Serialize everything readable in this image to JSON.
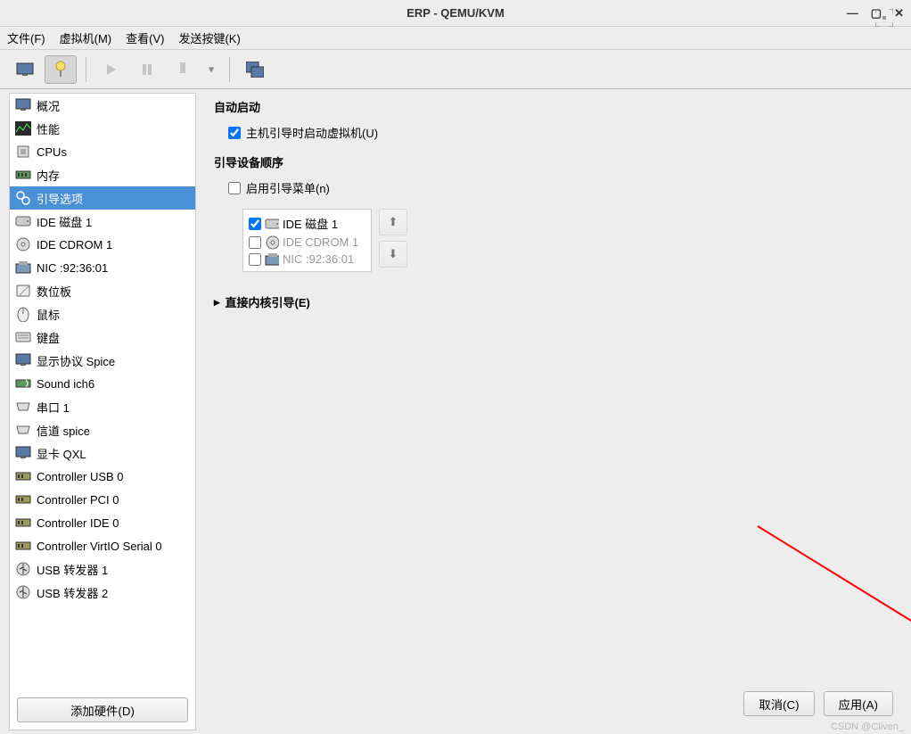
{
  "window": {
    "title": "ERP - QEMU/KVM"
  },
  "menu": {
    "file": "文件(F)",
    "vm": "虚拟机(M)",
    "view": "查看(V)",
    "sendkey": "发送按键(K)"
  },
  "sidebar": {
    "items": [
      {
        "label": "概况",
        "icon": "monitor"
      },
      {
        "label": "性能",
        "icon": "perf"
      },
      {
        "label": "CPUs",
        "icon": "cpu"
      },
      {
        "label": "内存",
        "icon": "mem"
      },
      {
        "label": "引导选项",
        "icon": "boot",
        "selected": true
      },
      {
        "label": "IDE 磁盘 1",
        "icon": "disk"
      },
      {
        "label": "IDE CDROM 1",
        "icon": "cdrom"
      },
      {
        "label": "NIC :92:36:01",
        "icon": "nic"
      },
      {
        "label": "数位板",
        "icon": "tablet"
      },
      {
        "label": "鼠标",
        "icon": "mouse"
      },
      {
        "label": "键盘",
        "icon": "keyboard"
      },
      {
        "label": "显示协议 Spice",
        "icon": "display"
      },
      {
        "label": "Sound ich6",
        "icon": "sound"
      },
      {
        "label": "串口 1",
        "icon": "serial"
      },
      {
        "label": "信道 spice",
        "icon": "channel"
      },
      {
        "label": "显卡 QXL",
        "icon": "video"
      },
      {
        "label": "Controller USB 0",
        "icon": "ctrl"
      },
      {
        "label": "Controller PCI 0",
        "icon": "ctrl"
      },
      {
        "label": "Controller IDE 0",
        "icon": "ctrl"
      },
      {
        "label": "Controller VirtIO Serial 0",
        "icon": "ctrl"
      },
      {
        "label": "USB 转发器 1",
        "icon": "usb"
      },
      {
        "label": "USB 转发器 2",
        "icon": "usb"
      }
    ],
    "add_hw": "添加硬件(D)"
  },
  "content": {
    "autostart": {
      "title": "自动启动",
      "checkbox_label": "主机引导时启动虚拟机(U)",
      "checked": true
    },
    "bootorder": {
      "title": "引导设备顺序",
      "enable_menu": "启用引导菜单(n)",
      "enable_menu_checked": false,
      "items": [
        {
          "label": "IDE 磁盘 1",
          "checked": true,
          "icon": "disk"
        },
        {
          "label": "IDE CDROM 1",
          "checked": false,
          "icon": "cdrom",
          "disabled": true
        },
        {
          "label": "NIC :92:36:01",
          "checked": false,
          "icon": "nic",
          "disabled": true
        }
      ]
    },
    "direct_kernel": "直接内核引导(E)"
  },
  "buttons": {
    "cancel": "取消(C)",
    "apply": "应用(A)"
  },
  "watermark": "CSDN @Cliven_"
}
